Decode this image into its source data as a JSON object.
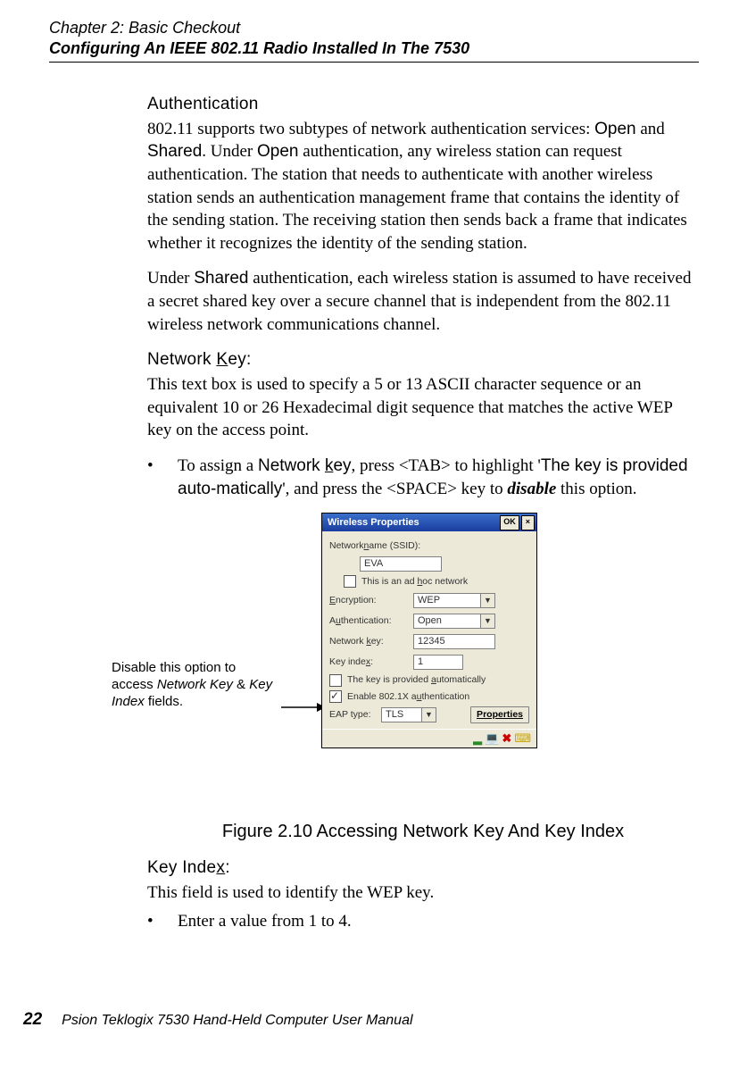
{
  "header": {
    "chapter": "Chapter 2: Basic Checkout",
    "section": "Configuring An IEEE 802.11 Radio Installed In The 7530"
  },
  "auth": {
    "heading": "Authentication",
    "p1a": "802.11 supports two subtypes of network authentication services: ",
    "open": "Open",
    "p1b": " and ",
    "shared": "Shared",
    "p1c": ". Under ",
    "open2": "Open",
    "p1d": " authentication, any wireless station can request authentication. The station that needs to authenticate with another wireless station sends an authentication management frame that contains the identity of the sending station. The receiving station then sends back a frame that indicates whether it recognizes the identity of the sending station.",
    "p2a": "Under ",
    "shared2": "Shared",
    "p2b": " authentication, each wireless station is assumed to have received a secret shared key over a secure channel that is independent from the 802.11 wireless network communications channel."
  },
  "netkey": {
    "heading_a": "Network ",
    "heading_k": "K",
    "heading_b": "ey:",
    "p": "This text box is used to specify a 5 or 13 ASCII character sequence or an equivalent 10 or 26 Hexadecimal digit sequence that matches the active WEP key on the access point.",
    "bullet_a": "To assign a ",
    "bullet_term_a": "Network ",
    "bullet_term_k": "k",
    "bullet_term_b": "ey",
    "bullet_b": ", press <TAB> to highlight ",
    "bullet_q1": "'",
    "bullet_quote": "The key is provided auto-matically",
    "bullet_q2": "'",
    "bullet_c": ", and press the <SPACE> key to ",
    "bullet_disable": "disable",
    "bullet_d": " this option."
  },
  "callout": {
    "l1": "Disable this option to access ",
    "l2": "Network Key",
    "l3": " & ",
    "l4": "Key Index",
    "l5": " fields."
  },
  "dialog": {
    "title": "Wireless Properties",
    "ok": "OK",
    "close": "×",
    "ssid_lbl_a": "Network ",
    "ssid_lbl_u": "n",
    "ssid_lbl_b": "ame (SSID):",
    "ssid_val": "EVA",
    "adhoc_a": "This is an ad ",
    "adhoc_u": "h",
    "adhoc_b": "oc network",
    "enc_lbl_u": "E",
    "enc_lbl": "ncryption:",
    "enc_val": "WEP",
    "authn_lbl_a": "A",
    "authn_lbl_u": "u",
    "authn_lbl_b": "thentication:",
    "authn_val": "Open",
    "nkey_lbl_a": "Network ",
    "nkey_lbl_u": "k",
    "nkey_lbl_b": "ey:",
    "nkey_val": "12345",
    "kidx_lbl_a": "Key inde",
    "kidx_lbl_u": "x",
    "kidx_lbl_b": ":",
    "kidx_val": "1",
    "auto_a": "The key is provided ",
    "auto_u": "a",
    "auto_b": "utomatically",
    "dot1x_a": "Enable 802.1X a",
    "dot1x_u": "u",
    "dot1x_b": "thentication",
    "eap_lbl": "EAP type:",
    "eap_val": "TLS",
    "props_u": "P",
    "props": "roperties"
  },
  "figcaption": "Figure 2.10 Accessing Network Key And Key Index",
  "kidx": {
    "heading_a": "Key Inde",
    "heading_u": "x",
    "heading_b": ":",
    "p": "This field is used to identify the WEP key.",
    "bullet": "Enter a value from 1 to 4."
  },
  "footer": {
    "page": "22",
    "text": "Psion Teklogix 7530 Hand-Held Computer User Manual"
  }
}
